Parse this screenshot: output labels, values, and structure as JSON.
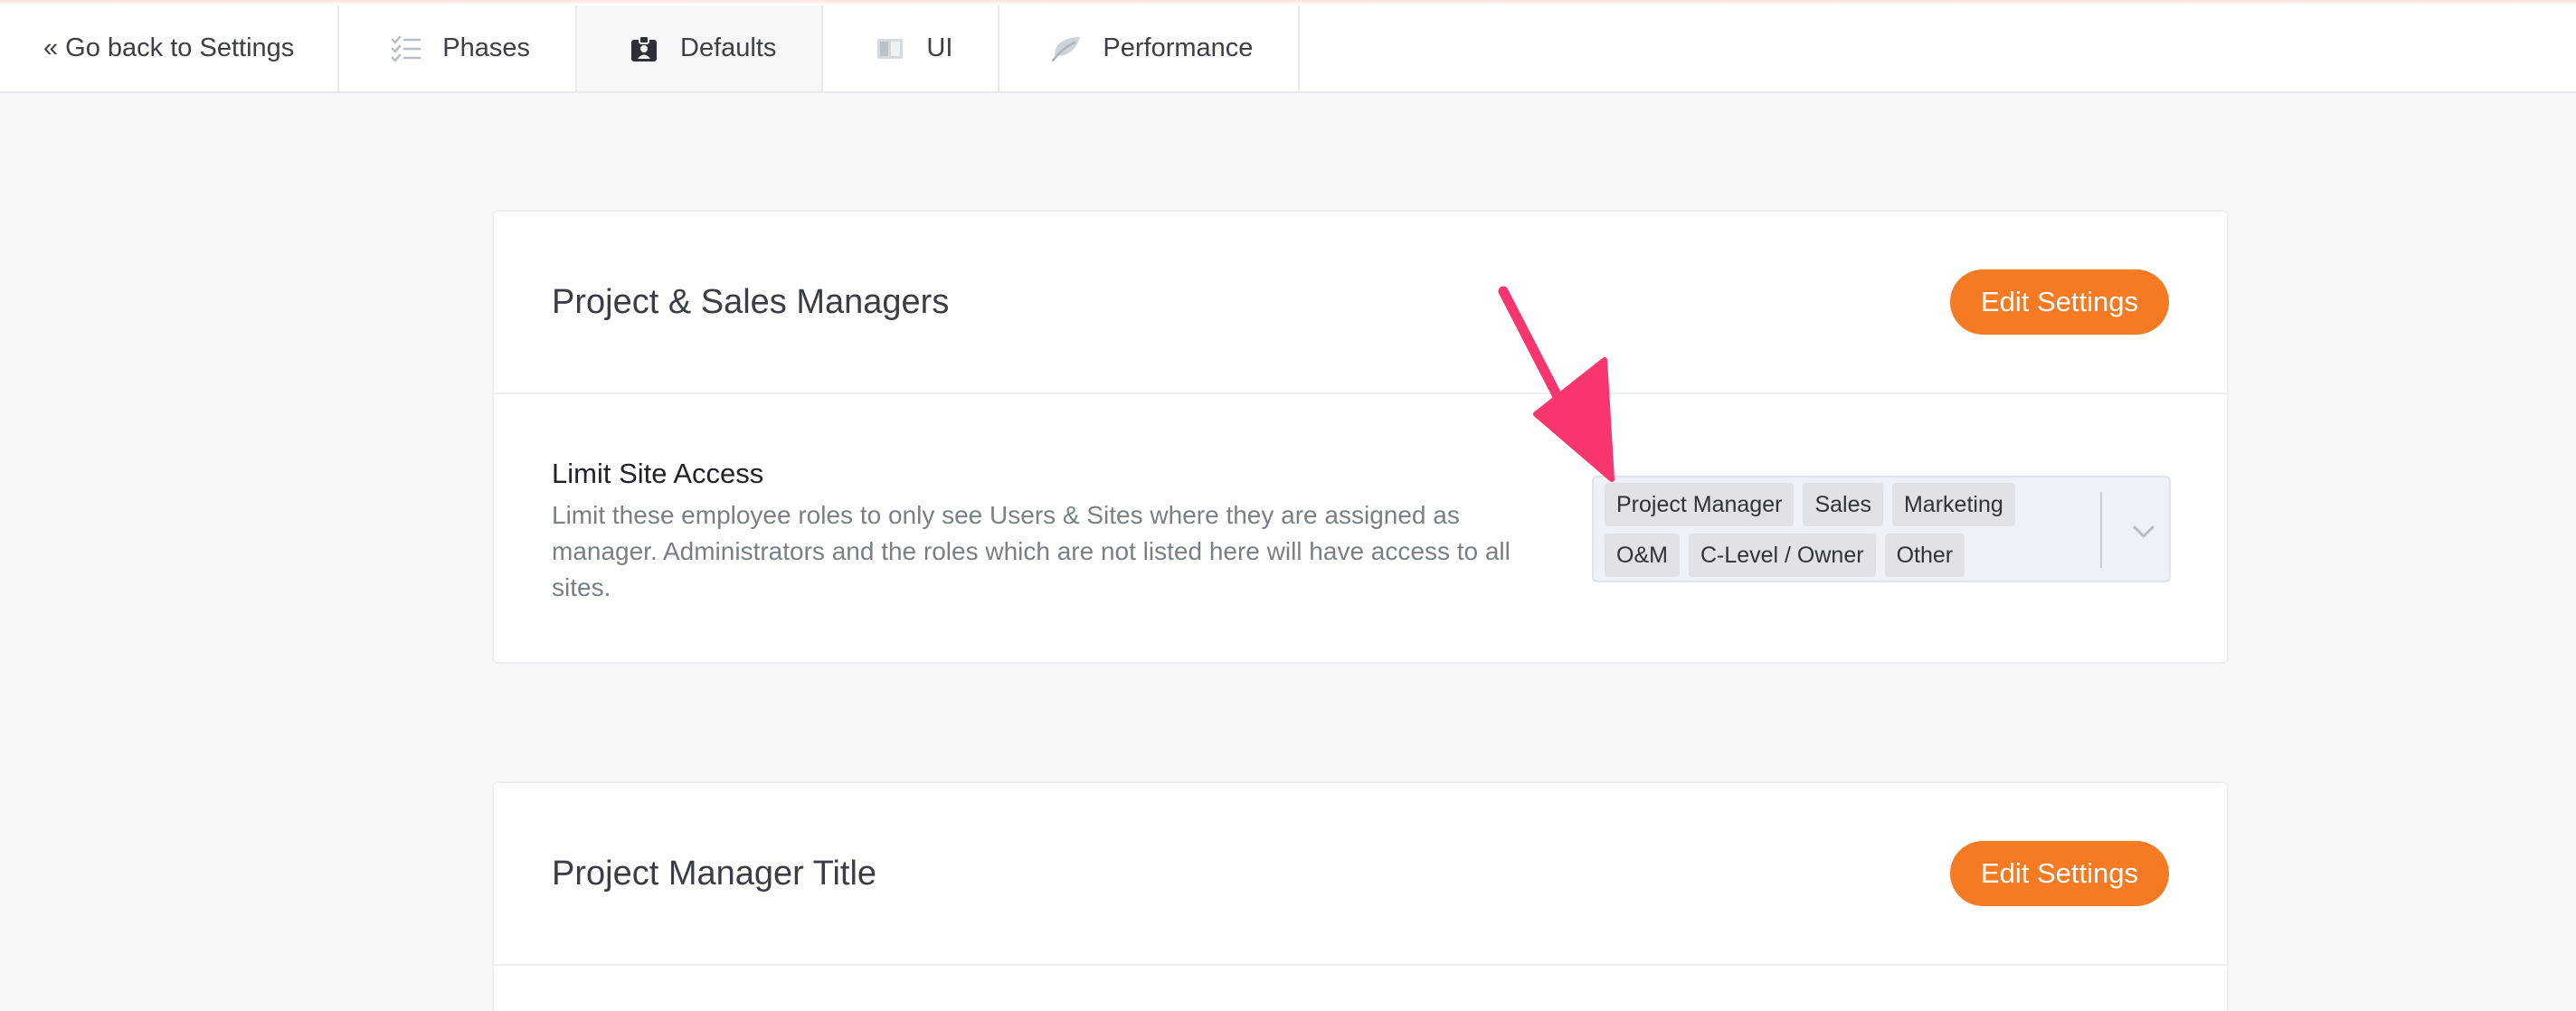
{
  "tabs": {
    "back": "« Go back to Settings",
    "items": [
      {
        "label": "Phases",
        "icon": "checklist-icon"
      },
      {
        "label": "Defaults",
        "icon": "id-badge-icon",
        "active": true
      },
      {
        "label": "UI",
        "icon": "layout-icon"
      },
      {
        "label": "Performance",
        "icon": "leaf-icon"
      }
    ]
  },
  "section1": {
    "title": "Project & Sales Managers",
    "edit_label": "Edit Settings",
    "setting": {
      "label": "Limit Site Access",
      "description": "Limit these employee roles to only see Users & Sites where they are assigned as manager. Administrators and the roles which are not listed here will have access to all sites."
    },
    "roles": [
      "Project Manager",
      "Sales",
      "Marketing",
      "O&M",
      "C-Level / Owner",
      "Other"
    ]
  },
  "section2": {
    "title": "Project Manager Title",
    "edit_label": "Edit Settings"
  },
  "colors": {
    "accent": "#f47a24",
    "annotation_arrow": "#f7356e"
  }
}
